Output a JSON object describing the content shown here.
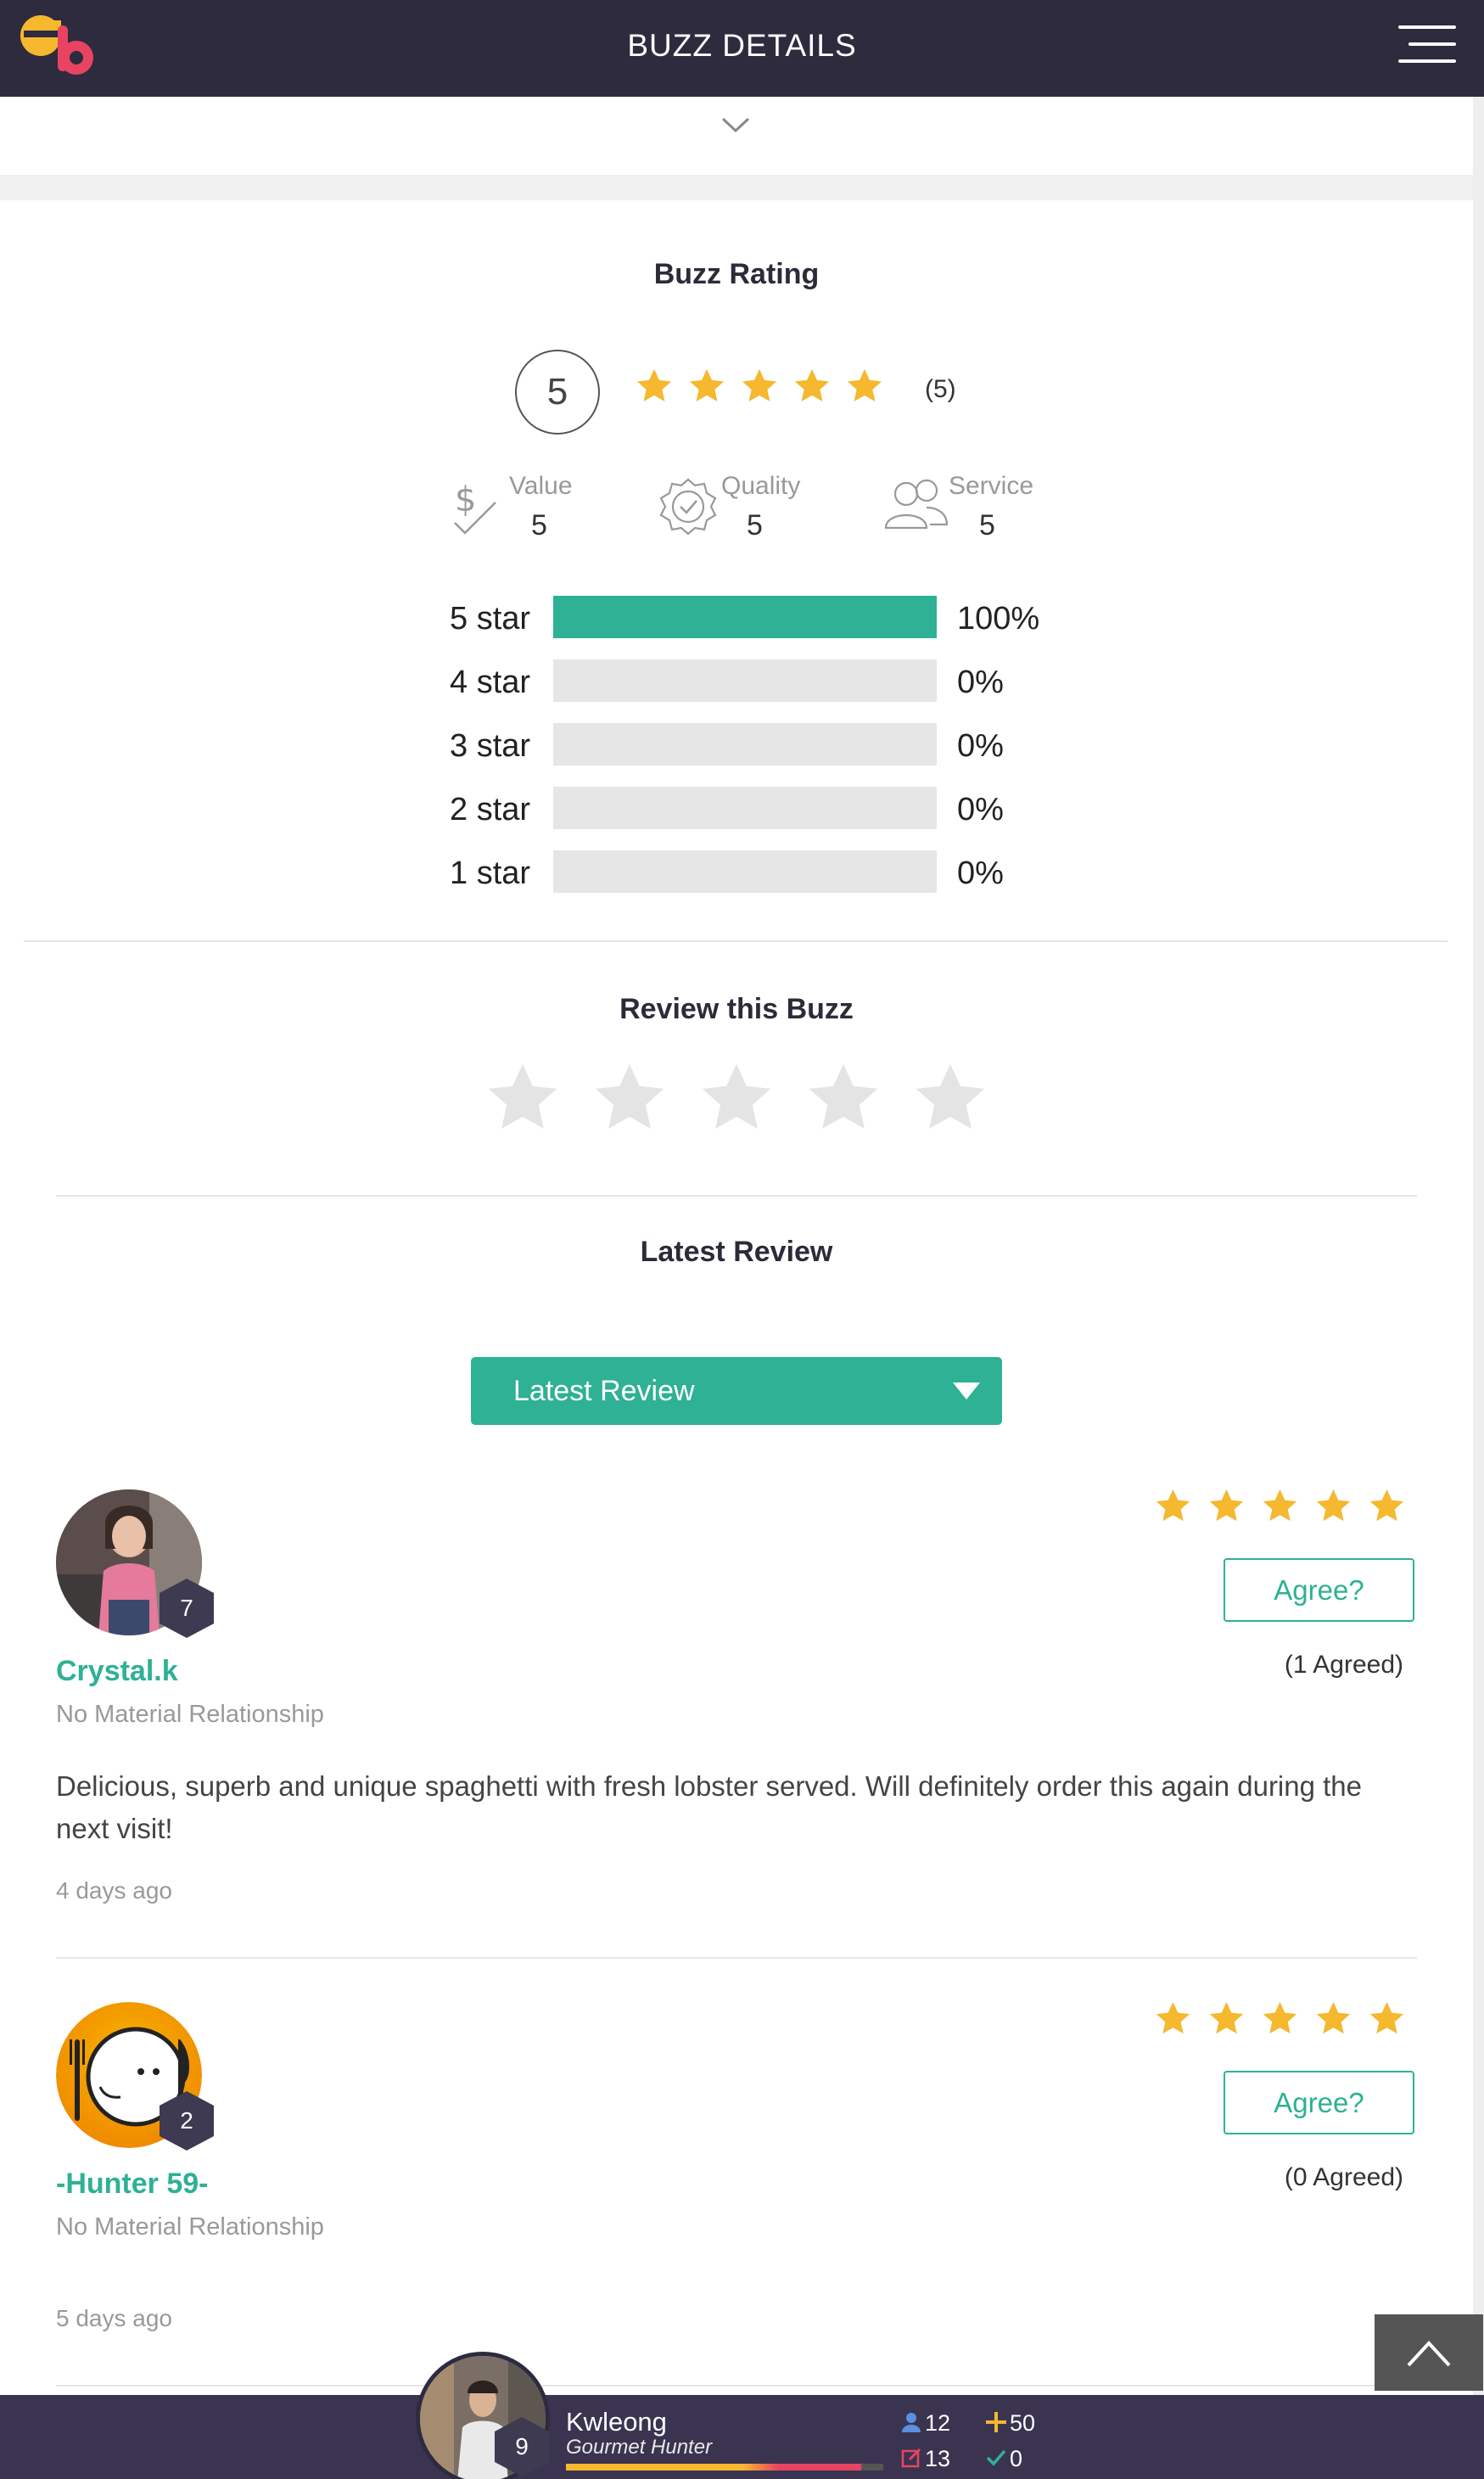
{
  "header": {
    "title": "BUZZ DETAILS",
    "logo_icon": "eb-logo-icon",
    "menu_icon": "hamburger-menu-icon",
    "collapse_icon": "chevron-down-icon"
  },
  "colors": {
    "header_bg": "#2e2b3f",
    "accent": "#2eb195",
    "star": "#f5b82e",
    "star_empty": "#e4e4e4"
  },
  "rating": {
    "title": "Buzz Rating",
    "score": "5",
    "stars": 5,
    "count": "(5)",
    "criteria": [
      {
        "label": "Value",
        "value": "5",
        "icon": "dollar-check-icon"
      },
      {
        "label": "Quality",
        "value": "5",
        "icon": "quality-badge-icon"
      },
      {
        "label": "Service",
        "value": "5",
        "icon": "users-icon"
      }
    ],
    "distribution": [
      {
        "label": "5 star",
        "percent": "100%",
        "fraction": 1.0
      },
      {
        "label": "4 star",
        "percent": "0%",
        "fraction": 0
      },
      {
        "label": "3 star",
        "percent": "0%",
        "fraction": 0
      },
      {
        "label": "2 star",
        "percent": "0%",
        "fraction": 0
      },
      {
        "label": "1 star",
        "percent": "0%",
        "fraction": 0
      }
    ]
  },
  "review_this": {
    "title": "Review this Buzz",
    "stars": 5
  },
  "latest": {
    "title": "Latest Review",
    "sort_selected": "Latest Review"
  },
  "reviews": [
    {
      "name": "Crystal.k",
      "level": "7",
      "relationship": "No Material Relationship",
      "text": "Delicious, superb and unique spaghetti with fresh lobster served. Will definitely order this again during the next visit!",
      "time": "4 days ago",
      "stars": 5,
      "agree_label": "Agree?",
      "agreed": "(1 Agreed)"
    },
    {
      "name": "-Hunter 59-",
      "level": "2",
      "relationship": "No Material Relationship",
      "text": "",
      "time": "5 days ago",
      "stars": 5,
      "agree_label": "Agree?",
      "agreed": "(0 Agreed)"
    }
  ],
  "back_to_top_icon": "arrow-up-icon",
  "user": {
    "name": "Kwleong",
    "title": "Gourmet Hunter",
    "level": "9",
    "xp_fraction": 0.93,
    "followers": "12",
    "posts": "13",
    "points": "50",
    "checks": "0"
  }
}
